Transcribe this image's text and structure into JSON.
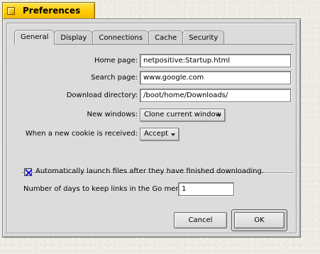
{
  "window": {
    "title": "Preferences"
  },
  "tabs": [
    {
      "label": "General",
      "active": true
    },
    {
      "label": "Display",
      "active": false
    },
    {
      "label": "Connections",
      "active": false
    },
    {
      "label": "Cache",
      "active": false
    },
    {
      "label": "Security",
      "active": false
    }
  ],
  "general": {
    "home_page": {
      "label": "Home page:",
      "value": "netpositive:Startup.html"
    },
    "search_page": {
      "label": "Search page:",
      "value": "www.google.com"
    },
    "download_directory": {
      "label": "Download directory:",
      "value": "/boot/home/Downloads/"
    },
    "new_windows": {
      "label": "New windows:",
      "value": "Clone current window"
    },
    "cookie": {
      "label": "When a new cookie is received:",
      "value": "Accept"
    },
    "auto_launch": {
      "label": "Automatically launch files after they have finished downloading.",
      "checked": true
    },
    "go_menu_days": {
      "label": "Number of days to keep links in the Go menu:",
      "value": "1"
    }
  },
  "buttons": {
    "cancel": "Cancel",
    "ok": "OK"
  },
  "colors": {
    "title_tab": "#ffcb00",
    "window_bg": "#d8d8d8",
    "checkmark": "#1a1ad6"
  }
}
